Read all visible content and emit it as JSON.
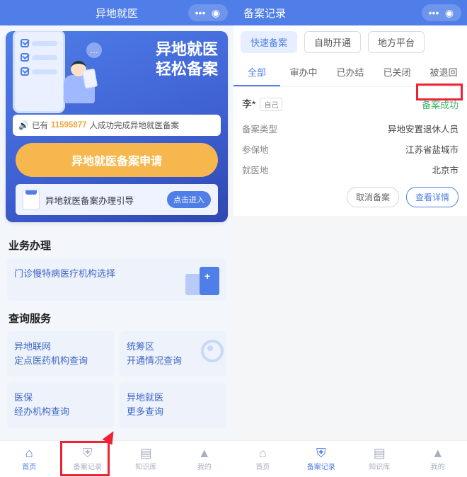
{
  "left": {
    "header": {
      "title": "异地就医"
    },
    "hero": {
      "line1": "异地就医",
      "line2": "轻松备案",
      "count_prefix": "已有",
      "count_num": "11595877",
      "count_suffix": "人成功完成异地就医备案"
    },
    "big_btn": "异地就医备案申请",
    "guide": {
      "text": "异地就医备案办理引导",
      "chip": "点击进入"
    },
    "sect_biz": "业务办理",
    "card_chronic": "门诊慢特病医疗机构选择",
    "sect_query": "查询服务",
    "q1": {
      "l1": "异地联网",
      "l2": "定点医药机构查询"
    },
    "q2": {
      "l1": "统筹区",
      "l2": "开通情况查询"
    },
    "q3": {
      "l1": "医保",
      "l2": "经办机构查询"
    },
    "q4": {
      "l1": "异地就医",
      "l2": "更多查询"
    },
    "tabs": {
      "home": "首页",
      "record": "备案记录",
      "kb": "知识库",
      "me": "我的"
    }
  },
  "right": {
    "header": {
      "title": "备案记录"
    },
    "chips": {
      "fast": "快速备案",
      "self": "自助开通",
      "local": "地方平台"
    },
    "tabs": {
      "all": "全部",
      "doing": "审办中",
      "done": "已办结",
      "closed": "已关闭",
      "back": "被退回"
    },
    "rec": {
      "name": "李*",
      "rel": "自己",
      "status": "备案成功",
      "kv1_k": "备案类型",
      "kv1_v": "异地安置退休人员",
      "kv2_k": "参保地",
      "kv2_v": "江苏省盐城市",
      "kv3_k": "就医地",
      "kv3_v": "北京市",
      "act_cancel": "取消备案",
      "act_detail": "查看详情"
    },
    "tabs_btm": {
      "home": "首页",
      "record": "备案记录",
      "kb": "知识库",
      "me": "我的"
    }
  }
}
